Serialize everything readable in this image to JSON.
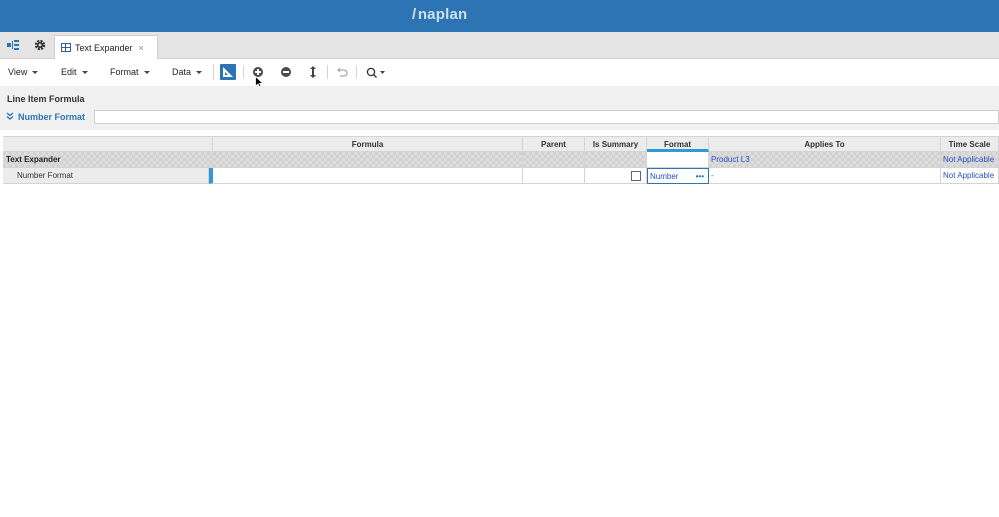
{
  "header": {
    "logo": "/ naplan"
  },
  "tabstrip": {
    "active_tab": {
      "label": "Text Expander",
      "close": "×"
    },
    "icons": [
      "tree-icon",
      "gear-icon"
    ]
  },
  "toolbar": {
    "menus": [
      {
        "label": "View"
      },
      {
        "label": "Edit"
      },
      {
        "label": "Format"
      },
      {
        "label": "Data"
      }
    ],
    "buttons": [
      "formula-toggle-icon",
      "insert-icon",
      "delete-icon",
      "move-icon",
      "undo-icon",
      "search-icon"
    ]
  },
  "formula_panel": {
    "title": "Line Item Formula",
    "selected": "Number Format",
    "formula_value": ""
  },
  "grid": {
    "columns": [
      "",
      "Formula",
      "Parent",
      "Is Summary",
      "Format",
      "Applies To",
      "Time Scale"
    ],
    "rows": [
      {
        "label": "Text Expander",
        "formula": "",
        "parent": "",
        "is_summary": "",
        "format": "",
        "applies_to": "Product L3",
        "time_scale": "Not Applicable"
      },
      {
        "label": "Number Format",
        "formula": "",
        "parent": "",
        "is_summary": false,
        "format": "Number",
        "format_dots": "•••",
        "applies_to": "-",
        "time_scale": "Not Applicable"
      }
    ]
  },
  "colors": {
    "brand": "#2d74b4",
    "accent": "#2d9bd6",
    "link": "#2a4fc2"
  }
}
